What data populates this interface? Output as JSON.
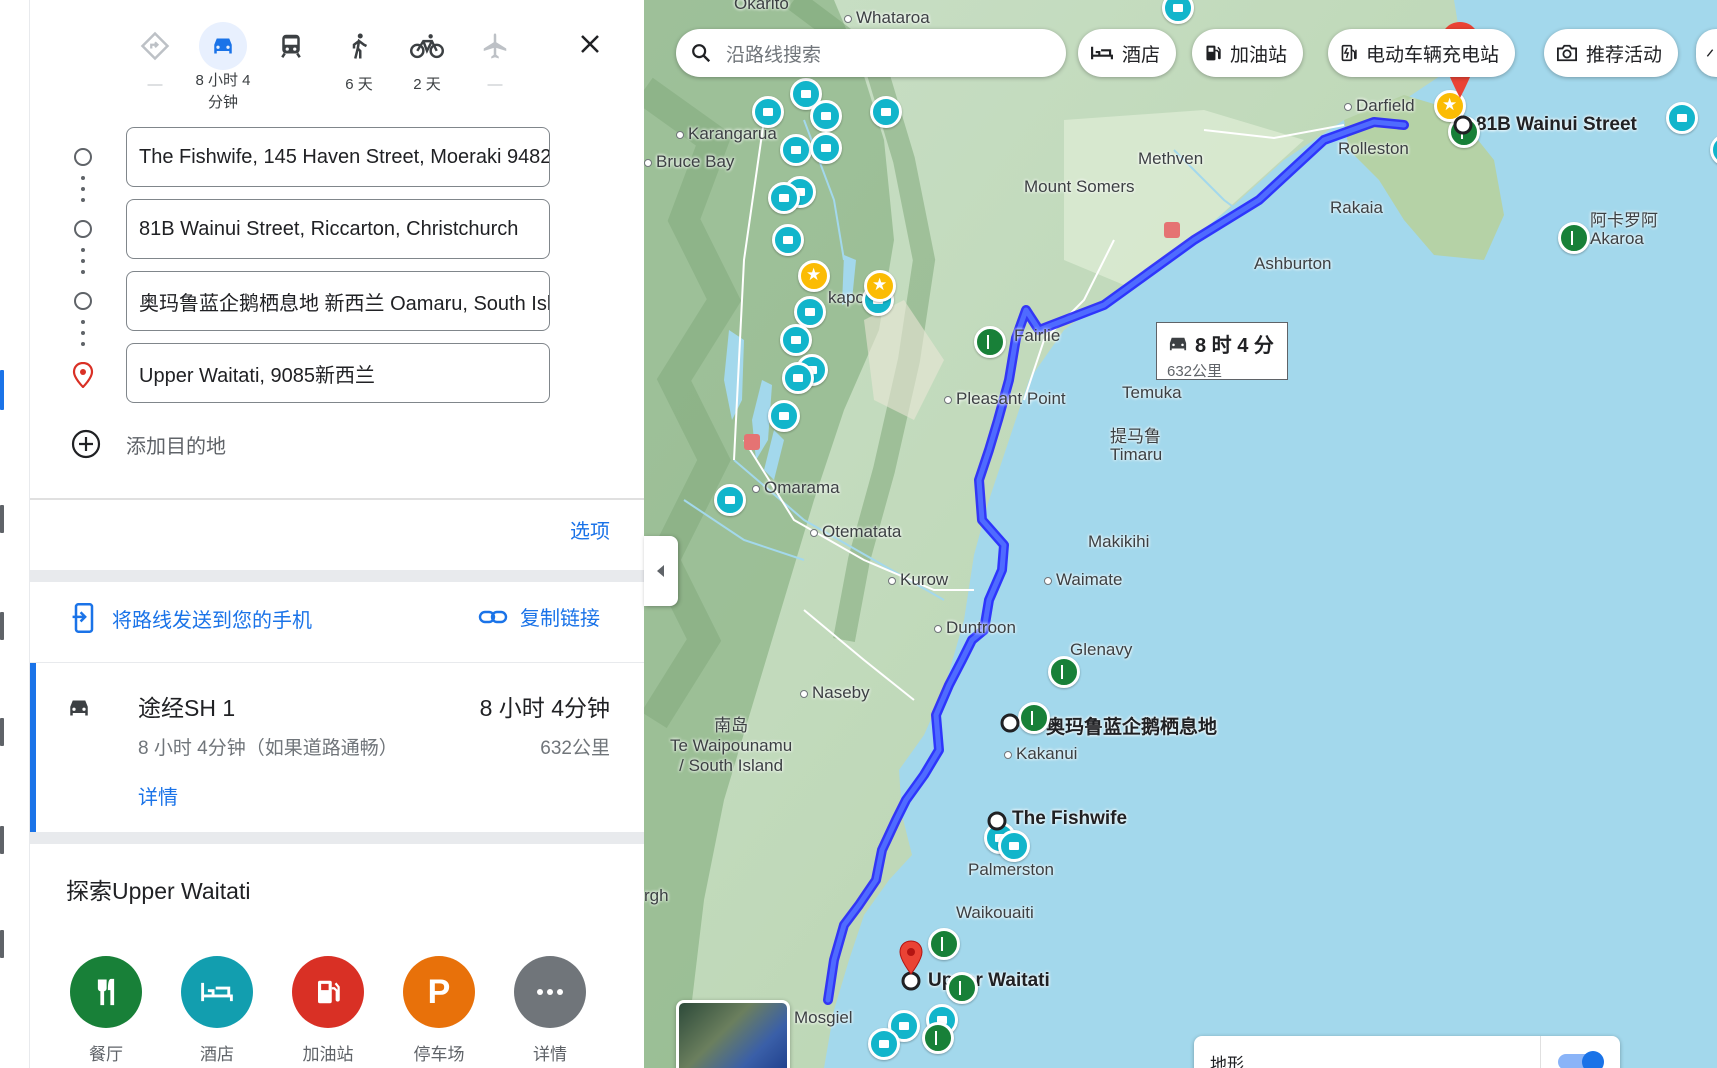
{
  "modes": [
    {
      "name": "best",
      "label": "—",
      "dim": true
    },
    {
      "name": "drive",
      "label": "8 小时 4 分钟",
      "active": true
    },
    {
      "name": "transit",
      "label": ""
    },
    {
      "name": "walk",
      "label": "6 天"
    },
    {
      "name": "bike",
      "label": "2 天"
    },
    {
      "name": "flight",
      "label": "—",
      "dim": true
    }
  ],
  "waypoints": [
    "The Fishwife, 145 Haven Street, Moeraki 9482",
    "81B Wainui Street, Riccarton, Christchurch",
    "奥玛鲁蓝企鹅栖息地 新西兰 Oamaru, South Island",
    "Upper Waitati, 9085新西兰"
  ],
  "add_destination": "添加目的地",
  "options": "选项",
  "send_to_phone": "将路线发送到您的手机",
  "copy_link": "复制链接",
  "route": {
    "name": "途经SH 1",
    "time": "8 小时 4分钟",
    "sub": "8 小时 4分钟（如果道路通畅）",
    "distance": "632公里",
    "details": "详情"
  },
  "explore": {
    "title": "探索Upper Waitati",
    "categories": [
      {
        "label": "餐厅",
        "color": "#188038",
        "icon": "restaurant-icon"
      },
      {
        "label": "酒店",
        "color": "#129eaf",
        "icon": "hotel-icon"
      },
      {
        "label": "加油站",
        "color": "#d93025",
        "icon": "gas-icon"
      },
      {
        "label": "停车场",
        "color": "#e8710a",
        "icon": "parking-icon"
      },
      {
        "label": "详情",
        "color": "#70757a",
        "icon": "more-icon"
      }
    ]
  },
  "map": {
    "search_placeholder": "沿路线搜索",
    "chips": [
      "酒店",
      "加油站",
      "电动车辆充电站",
      "推荐活动"
    ],
    "duration_label": "8 时 4 分",
    "duration_distance": "632公里",
    "terrain_label": "地形",
    "places": {
      "okarito": "Okarito",
      "whataroa": "Whataroa",
      "karangarua": "Karangarua",
      "bruce_bay": "Bruce Bay",
      "darfield": "Darfield",
      "rolleston": "Rolleston",
      "methven": "Methven",
      "mount_somers": "Mount Somers",
      "rakaia": "Rakaia",
      "ashburton": "Ashburton",
      "akaroa": "阿卡罗阿\nAkaroa",
      "fairlie": "Fairlie",
      "pleasant_point": "Pleasant Point",
      "temuka": "Temuka",
      "timaru": "提马鲁\nTimaru",
      "omarama": "Omarama",
      "otematata": "Otematata",
      "makikihi": "Makikihi",
      "kurow": "Kurow",
      "waimate": "Waimate",
      "duntroon": "Duntroon",
      "glenavy": "Glenavy",
      "naseby": "Naseby",
      "south_island": "南岛\nTe Waipounamu\n/ South Island",
      "oamaru_penguin": "奥玛鲁蓝企鹅栖息地",
      "kakanui": "Kakanui",
      "fishwife": "The Fishwife",
      "palmerston": "Palmerston",
      "waikouaiti": "Waikouaiti",
      "upper_waitati": "Upper Waitati",
      "mosgiel": "Mosgiel",
      "wainui": "81B Wainui Street",
      "tekapo": "kapo",
      "rgh": "rgh"
    }
  }
}
